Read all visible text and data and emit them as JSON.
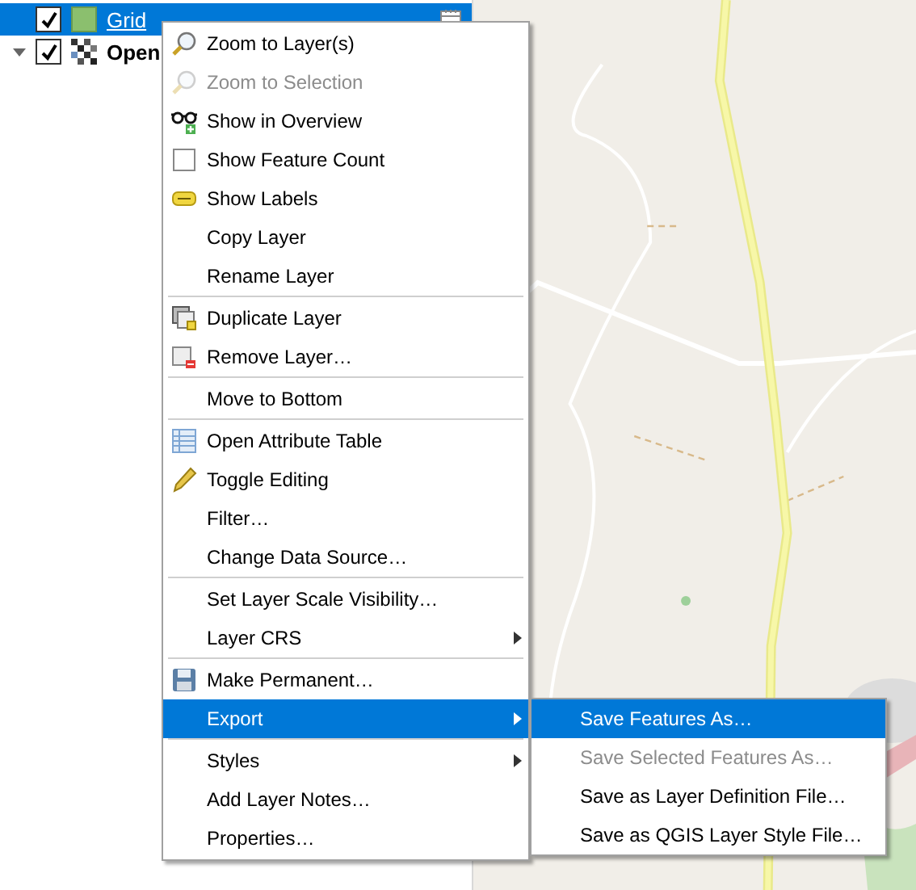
{
  "layers": [
    {
      "name": "Grid",
      "kind": "fill",
      "checked": true,
      "selected": true,
      "underlined": true
    },
    {
      "name": "Open",
      "kind": "raster",
      "checked": true,
      "selected": false,
      "expanded": true,
      "underlined": false
    }
  ],
  "context_menu": {
    "items": [
      {
        "kind": "zoom",
        "label": "Zoom to Layer(s)",
        "disabled": false,
        "selected": false,
        "has_submenu": false
      },
      {
        "kind": "zoom",
        "label": "Zoom to Selection",
        "disabled": true,
        "selected": false,
        "has_submenu": false
      },
      {
        "kind": "overview",
        "label": "Show in Overview",
        "disabled": false,
        "selected": false,
        "has_submenu": false
      },
      {
        "kind": "checkbox",
        "label": "Show Feature Count",
        "checked": false,
        "disabled": false,
        "selected": false,
        "has_submenu": false
      },
      {
        "kind": "labels",
        "label": "Show Labels",
        "disabled": false,
        "selected": false,
        "has_submenu": false
      },
      {
        "kind": "plain",
        "label": "Copy Layer",
        "disabled": false,
        "selected": false,
        "has_submenu": false
      },
      {
        "kind": "plain",
        "label": "Rename Layer",
        "disabled": false,
        "selected": false,
        "has_submenu": false
      },
      {
        "kind": "separator"
      },
      {
        "kind": "duplicate",
        "label": "Duplicate Layer",
        "disabled": false,
        "selected": false,
        "has_submenu": false
      },
      {
        "kind": "remove",
        "label": "Remove Layer…",
        "disabled": false,
        "selected": false,
        "has_submenu": false
      },
      {
        "kind": "separator"
      },
      {
        "kind": "plain",
        "label": "Move to Bottom",
        "disabled": false,
        "selected": false,
        "has_submenu": false
      },
      {
        "kind": "separator"
      },
      {
        "kind": "table",
        "label": "Open Attribute Table",
        "disabled": false,
        "selected": false,
        "has_submenu": false
      },
      {
        "kind": "pencil",
        "label": "Toggle Editing",
        "disabled": false,
        "selected": false,
        "has_submenu": false
      },
      {
        "kind": "plain",
        "label": "Filter…",
        "disabled": false,
        "selected": false,
        "has_submenu": false
      },
      {
        "kind": "plain",
        "label": "Change Data Source…",
        "disabled": false,
        "selected": false,
        "has_submenu": false
      },
      {
        "kind": "separator"
      },
      {
        "kind": "plain",
        "label": "Set Layer Scale Visibility…",
        "disabled": false,
        "selected": false,
        "has_submenu": false
      },
      {
        "kind": "plain",
        "label": "Layer CRS",
        "disabled": false,
        "selected": false,
        "has_submenu": true
      },
      {
        "kind": "separator"
      },
      {
        "kind": "save",
        "label": "Make Permanent…",
        "disabled": false,
        "selected": false,
        "has_submenu": false
      },
      {
        "kind": "plain",
        "label": "Export",
        "disabled": false,
        "selected": true,
        "has_submenu": true
      },
      {
        "kind": "separator"
      },
      {
        "kind": "plain",
        "label": "Styles",
        "disabled": false,
        "selected": false,
        "has_submenu": true
      },
      {
        "kind": "plain",
        "label": "Add Layer Notes…",
        "disabled": false,
        "selected": false,
        "has_submenu": false
      },
      {
        "kind": "plain",
        "label": "Properties…",
        "disabled": false,
        "selected": false,
        "has_submenu": false
      }
    ]
  },
  "submenu": {
    "items": [
      {
        "label": "Save Features As…",
        "disabled": false,
        "selected": true
      },
      {
        "label": "Save Selected Features As…",
        "disabled": true,
        "selected": false
      },
      {
        "label": "Save as Layer Definition File…",
        "disabled": false,
        "selected": false
      },
      {
        "label": "Save as QGIS Layer Style File…",
        "disabled": false,
        "selected": false
      }
    ]
  }
}
